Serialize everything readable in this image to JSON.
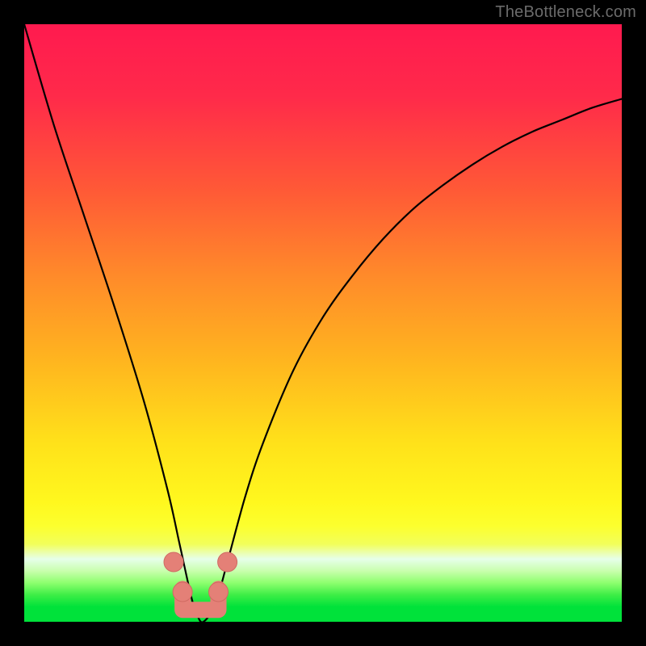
{
  "watermark": "TheBottleneck.com",
  "colors": {
    "black": "#000000",
    "curve": "#000000",
    "dot_fill": "#e48077",
    "dot_stroke": "#d06a62",
    "green_band": "#00e23a"
  },
  "gradient_stops": [
    {
      "pct": 0.0,
      "color": "#ff1a4f"
    },
    {
      "pct": 12.0,
      "color": "#ff2a4a"
    },
    {
      "pct": 28.0,
      "color": "#ff5a36"
    },
    {
      "pct": 42.0,
      "color": "#ff8a2a"
    },
    {
      "pct": 56.0,
      "color": "#ffb41f"
    },
    {
      "pct": 70.0,
      "color": "#ffe11a"
    },
    {
      "pct": 80.0,
      "color": "#fff81e"
    },
    {
      "pct": 84.0,
      "color": "#fcff2e"
    },
    {
      "pct": 87.0,
      "color": "#f2ff5a"
    },
    {
      "pct": 89.5,
      "color": "#e6ffea"
    },
    {
      "pct": 91.5,
      "color": "#c9ffad"
    },
    {
      "pct": 93.5,
      "color": "#8dff6e"
    },
    {
      "pct": 95.5,
      "color": "#3eee46"
    },
    {
      "pct": 97.5,
      "color": "#00e23a"
    },
    {
      "pct": 100.0,
      "color": "#00e23a"
    }
  ],
  "chart_data": {
    "type": "line",
    "title": "",
    "xlabel": "",
    "ylabel": "",
    "xlim": [
      0,
      100
    ],
    "ylim": [
      0,
      100
    ],
    "series": [
      {
        "name": "bottleneck-curve",
        "x": [
          0,
          5,
          10,
          15,
          20,
          24,
          26,
          28,
          29,
          30,
          32,
          34,
          37,
          40,
          45,
          50,
          55,
          60,
          65,
          70,
          75,
          80,
          85,
          90,
          95,
          100
        ],
        "values": [
          100,
          83,
          68,
          53,
          37,
          22,
          13,
          4,
          1,
          0,
          3,
          10,
          21,
          30,
          42,
          51,
          58,
          64,
          69,
          73,
          76.5,
          79.5,
          82,
          84,
          86,
          87.5
        ]
      }
    ],
    "markers": [
      {
        "name": "dot-left-upper",
        "x": 25.0,
        "y": 10.0
      },
      {
        "name": "dot-left-lower",
        "x": 26.5,
        "y": 5.0
      },
      {
        "name": "dot-right-lower",
        "x": 32.5,
        "y": 5.0
      },
      {
        "name": "dot-right-upper",
        "x": 34.0,
        "y": 10.0
      }
    ],
    "bracket": {
      "left_x": 26.5,
      "right_x": 32.5,
      "top_y": 5.5,
      "bottom_y": 2.0
    }
  }
}
